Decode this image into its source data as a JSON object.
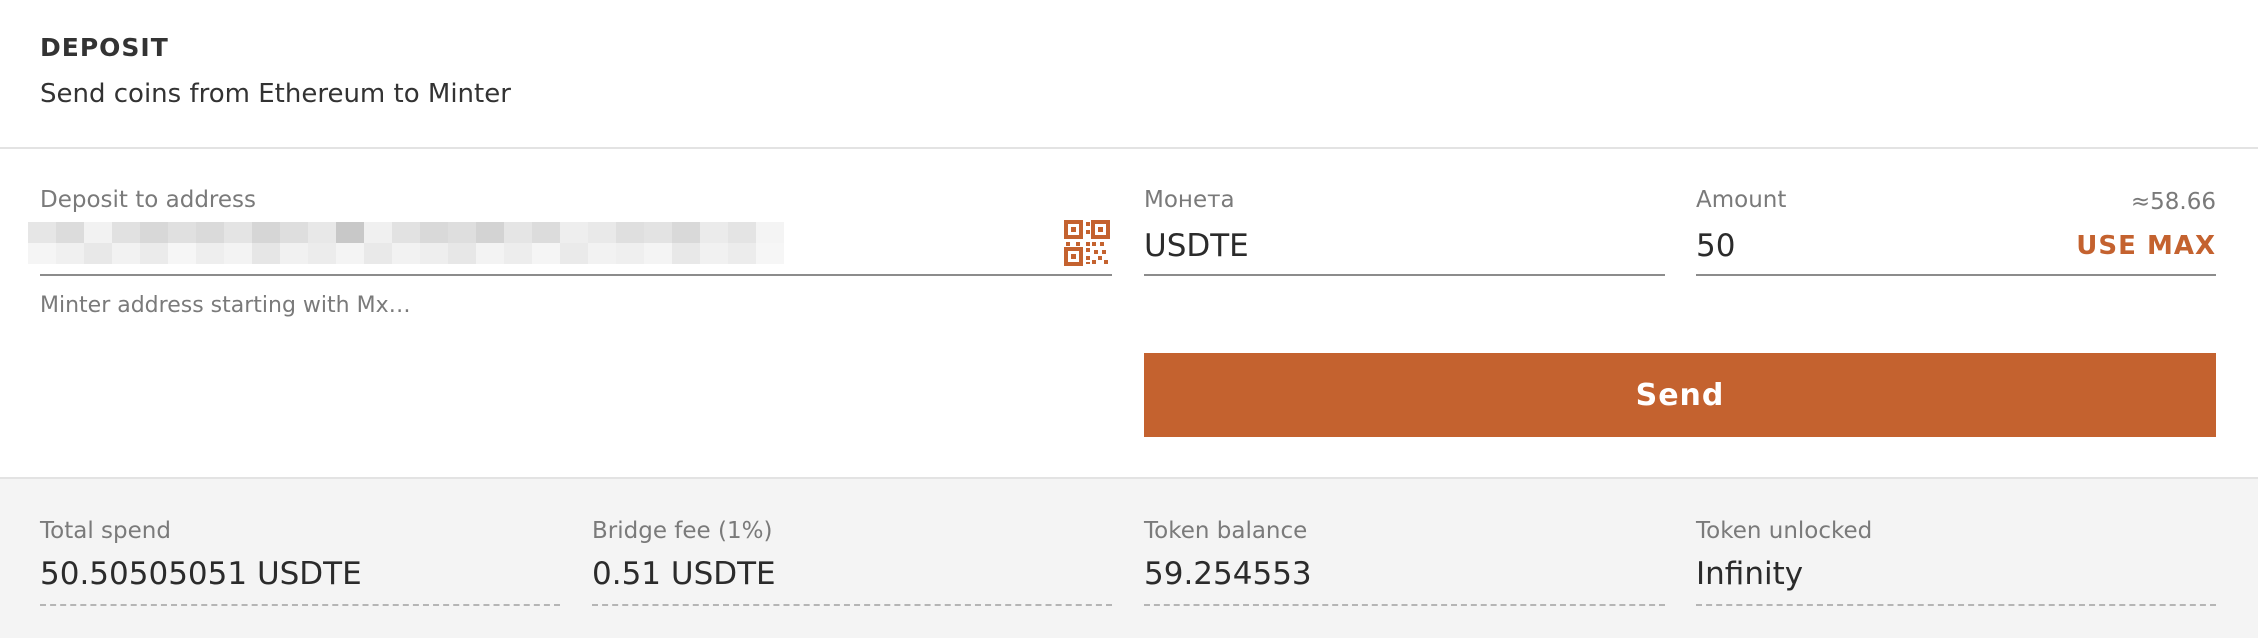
{
  "header": {
    "title": "DEPOSIT",
    "subtitle": "Send coins from Ethereum to Minter"
  },
  "deposit_address": {
    "label": "Deposit to address",
    "value_obscured": true,
    "hint": "Minter address starting with Mx…",
    "icon": "qr-code-icon"
  },
  "coin": {
    "label": "Монета",
    "value": "USDTE"
  },
  "amount": {
    "label": "Amount",
    "approx": "≈58.66",
    "value": "50",
    "use_max_label": "USE MAX"
  },
  "send_button": {
    "label": "Send"
  },
  "summary": [
    {
      "label": "Total spend",
      "value": "50.50505051 USDTE"
    },
    {
      "label": "Bridge fee (1%)",
      "value": "0.51 USDTE"
    },
    {
      "label": "Token balance",
      "value": "59.254553"
    },
    {
      "label": "Token unlocked",
      "value": "Infinity"
    }
  ],
  "colors": {
    "accent": "#c4622f",
    "footer_background": "#f4f4f4",
    "text": "#333333",
    "muted_text": "#7a7a7a"
  }
}
